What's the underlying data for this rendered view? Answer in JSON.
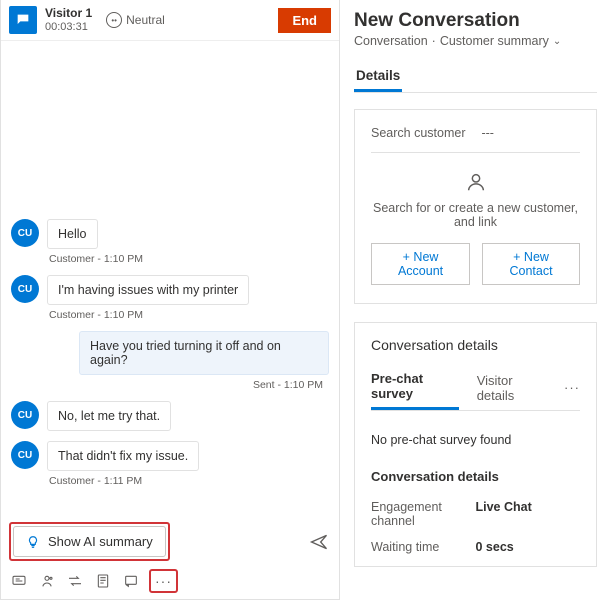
{
  "chat": {
    "visitor_name": "Visitor 1",
    "timer": "00:03:31",
    "sentiment": "Neutral",
    "end_label": "End",
    "avatar_initials": "CU",
    "messages": [
      {
        "from": "customer",
        "text": "Hello",
        "meta": "Customer - 1:10 PM"
      },
      {
        "from": "customer",
        "text": "I'm having issues with my printer",
        "meta": "Customer - 1:10 PM"
      },
      {
        "from": "agent",
        "text": "Have you tried turning it off and on again?",
        "meta": "Sent - 1:10 PM"
      },
      {
        "from": "customer",
        "text": "No, let me try that.",
        "meta": ""
      },
      {
        "from": "customer",
        "text": "That didn't fix my issue.",
        "meta": "Customer - 1:11 PM"
      }
    ],
    "ai_summary_label": "Show AI summary"
  },
  "right": {
    "title": "New Conversation",
    "breadcrumb_a": "Conversation",
    "breadcrumb_b": "Customer summary",
    "details_tab": "Details",
    "search_customer_label": "Search customer",
    "search_customer_value": "---",
    "empty_customer_text": "Search for or create a new customer, and link",
    "new_account_label": "+ New Account",
    "new_contact_label": "+ New Contact",
    "conv_details_title": "Conversation details",
    "subtab_pre": "Pre-chat survey",
    "subtab_vis": "Visitor details",
    "no_survey": "No pre-chat survey found",
    "section_heading": "Conversation details",
    "rows": [
      {
        "k": "Engagement channel",
        "v": "Live Chat"
      },
      {
        "k": "Waiting time",
        "v": "0 secs"
      }
    ]
  }
}
